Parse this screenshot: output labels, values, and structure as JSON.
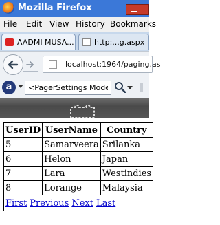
{
  "window": {
    "title": "Mozilla Firefox"
  },
  "menu": [
    {
      "label": "File",
      "hotkey": "F",
      "rest": "ile"
    },
    {
      "label": "Edit",
      "hotkey": "E",
      "rest": "dit"
    },
    {
      "label": "View",
      "hotkey": "V",
      "rest": "iew"
    },
    {
      "label": "History",
      "hotkey": "H",
      "rest": "istory"
    },
    {
      "label": "Bookmarks",
      "hotkey": "B",
      "rest": "ookmarks"
    }
  ],
  "tabs": [
    {
      "label": "AADMI MUSA..."
    },
    {
      "label": "http:...g.aspx"
    }
  ],
  "address": {
    "url": "localhost:1964/paging.as"
  },
  "search": {
    "value": "<PagerSettings Mode=\""
  },
  "grid": {
    "headers": [
      "UserID",
      "UserName",
      "Country"
    ],
    "rows": [
      [
        "5",
        "Samarveera",
        "Srilanka"
      ],
      [
        "6",
        "Helon",
        "Japan"
      ],
      [
        "7",
        "Lara",
        "Westindies"
      ],
      [
        "8",
        "Lorange",
        "Malaysia"
      ]
    ],
    "pager": [
      "First",
      "Previous",
      "Next",
      "Last"
    ]
  },
  "colors": {
    "titlebar": "#3b78d8",
    "link": "#0000cc"
  }
}
